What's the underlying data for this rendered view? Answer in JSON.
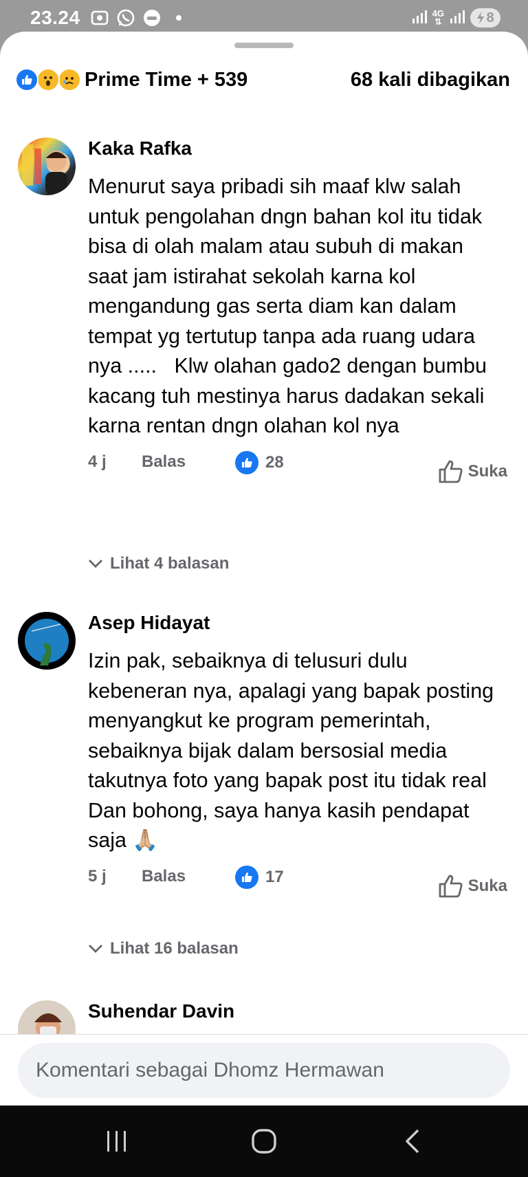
{
  "status_bar": {
    "time": "23.24",
    "battery": "8",
    "network": "4G"
  },
  "header": {
    "reactions_label": "Prime Time + 539",
    "shares_label": "68 kali dibagikan",
    "reaction_icons": [
      "like-icon",
      "wow-icon",
      "sad-icon"
    ]
  },
  "comments": [
    {
      "author": "Kaka Rafka",
      "text": "Menurut saya pribadi sih maaf klw salah untuk pengolahan dngn bahan kol itu tidak bisa di olah malam atau subuh di makan saat jam istirahat sekolah karna kol mengandung gas serta diam kan dalam tempat yg tertutup tanpa ada ruang udara nya .....   Klw olahan gado2 dengan bumbu kacang tuh mestinya harus dadakan sekali karna rentan dngn olahan kol nya",
      "time": "4 j",
      "reply_label": "Balas",
      "like_count": "28",
      "like_label": "Suka",
      "view_replies": "Lihat 4 balasan"
    },
    {
      "author": "Asep Hidayat",
      "text": "Izin pak, sebaiknya di telusuri dulu kebeneran nya, apalagi yang bapak posting menyangkut ke program pemerintah, sebaiknya bijak dalam bersosial media takutnya foto yang bapak post itu tidak real Dan bohong, saya hanya kasih pendapat saja 🙏🏼",
      "time": "5 j",
      "reply_label": "Balas",
      "like_count": "17",
      "like_label": "Suka",
      "view_replies": "Lihat 16 balasan"
    },
    {
      "author": "Suhendar Davin"
    }
  ],
  "comment_box": {
    "placeholder": "Komentari sebagai Dhomz Hermawan"
  },
  "colors": {
    "accent": "#1877f2",
    "secondary_text": "#65676b",
    "input_bg": "#f0f2f5"
  }
}
